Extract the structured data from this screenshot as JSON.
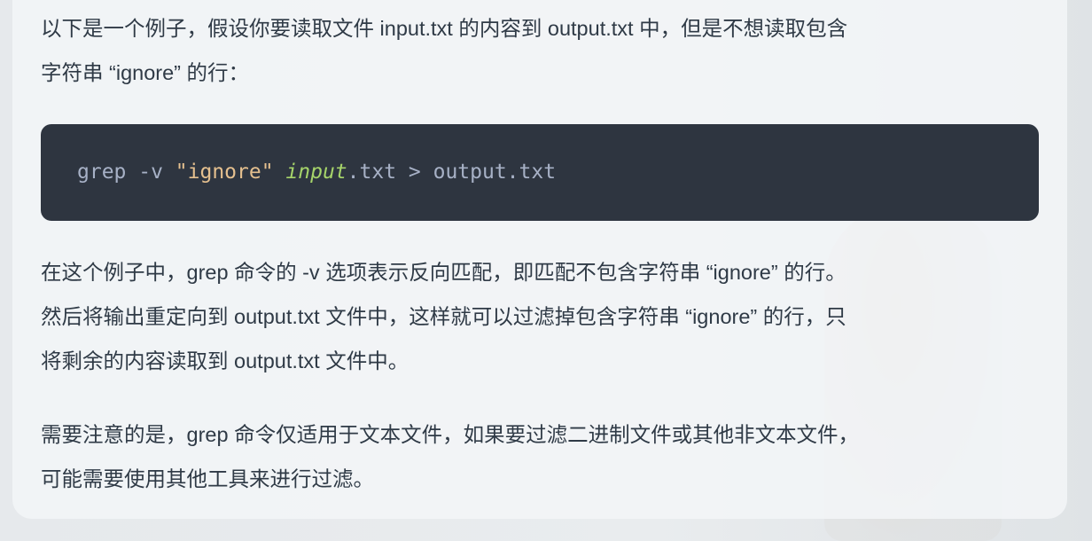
{
  "intro": [
    "以下是一个例子，假设你要读取文件 input.txt 的内容到 output.txt 中，但是不想读取包含",
    "字符串 “ignore” 的行："
  ],
  "code": {
    "cmd": "grep -v ",
    "string": "\"ignore\"",
    "space": " ",
    "arg_italic": "input",
    "rest": ".txt > output.txt"
  },
  "explanation": [
    "在这个例子中，grep 命令的 -v 选项表示反向匹配，即匹配不包含字符串 “ignore” 的行。",
    "然后将输出重定向到 output.txt 文件中，这样就可以过滤掉包含字符串 “ignore” 的行，只",
    "将剩余的内容读取到 output.txt 文件中。"
  ],
  "note": [
    "需要注意的是，grep 命令仅适用于文本文件，如果要过滤二进制文件或其他非文本文件，",
    "可能需要使用其他工具来进行过滤。"
  ],
  "colors": {
    "code_bg": "#2e3540",
    "code_text": "#a7b1c6",
    "string": "#e5c08f",
    "italic_arg": "#a6d46a",
    "body_text": "#2f3a46"
  }
}
